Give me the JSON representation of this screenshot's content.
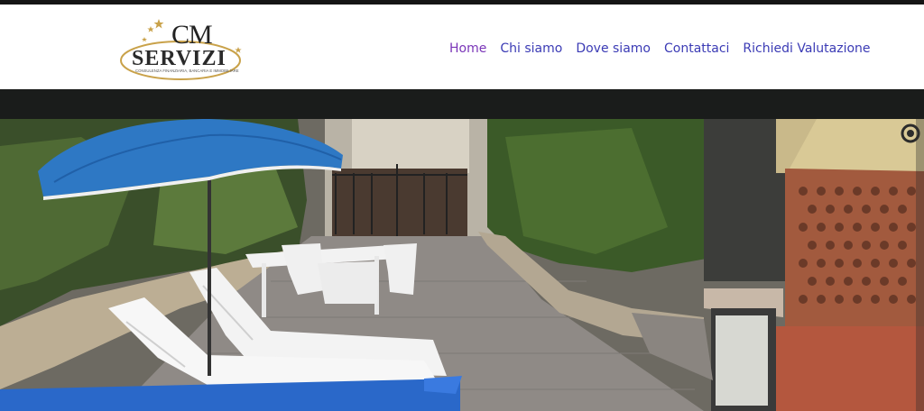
{
  "brand": {
    "mark": "CM",
    "name": "SERVIZI",
    "tagline": "CONSULENZA FINANZIARIA, BANCARIA E IMMOBILIARE"
  },
  "nav": {
    "items": [
      {
        "label": "Home",
        "active": true
      },
      {
        "label": "Chi siamo",
        "active": false
      },
      {
        "label": "Dove siamo",
        "active": false
      },
      {
        "label": "Contattaci",
        "active": false
      },
      {
        "label": "Richiedi Valutazione",
        "active": false
      }
    ]
  },
  "colors": {
    "nav_link": "#3b3bb5",
    "nav_active": "#7a35b8",
    "logo_gold": "#c9a24a",
    "logo_dark": "#222222",
    "umbrella": "#2e78c4"
  },
  "hero": {
    "scene": "patio-with-umbrella-and-loungers",
    "control_icon": "slider-pause-icon"
  }
}
